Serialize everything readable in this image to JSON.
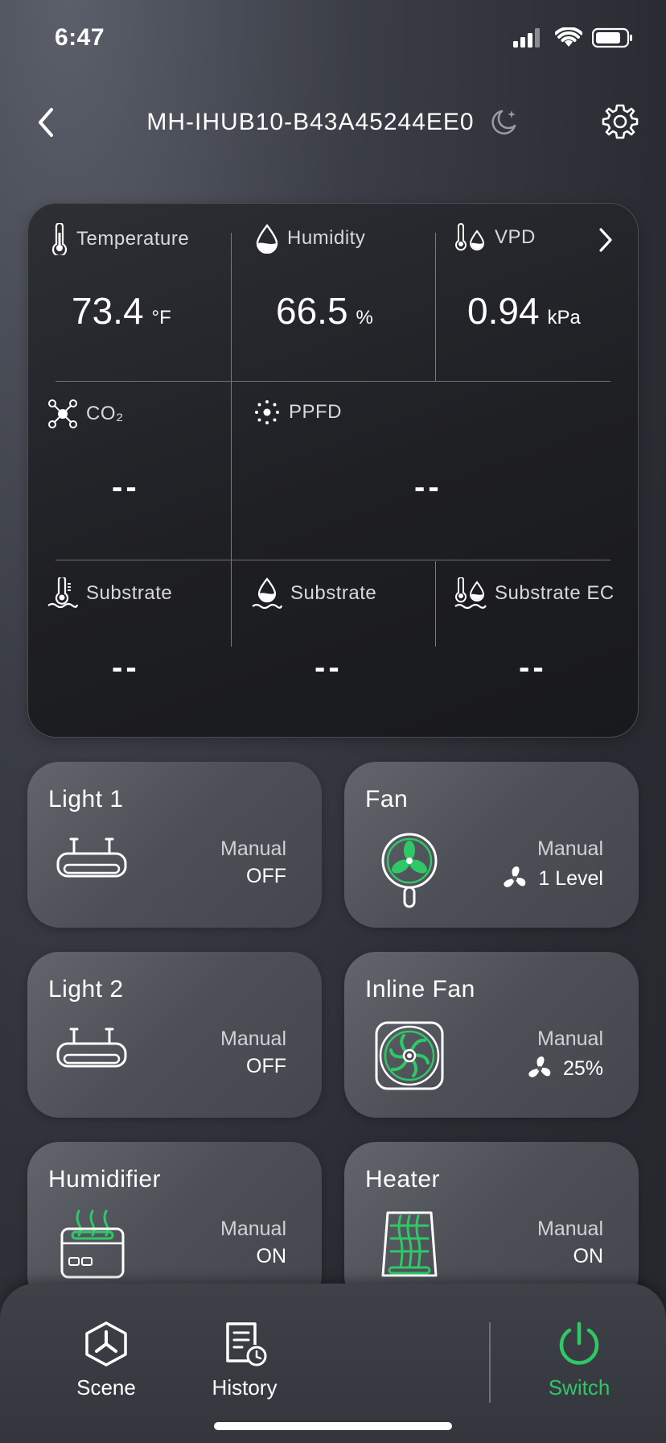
{
  "status_bar": {
    "time": "6:47",
    "icons": [
      "cellular-signal-icon",
      "wifi-icon",
      "battery-icon"
    ]
  },
  "header": {
    "title": "MH-IHUB10-B43A45244EE0",
    "icons": [
      "back-chevron-icon",
      "moon-icon",
      "gear-icon"
    ]
  },
  "sensors": {
    "temperature": {
      "label": "Temperature",
      "value": "73.4",
      "unit": "°F"
    },
    "humidity": {
      "label": "Humidity",
      "value": "66.5",
      "unit": "%"
    },
    "vpd": {
      "label": "VPD",
      "value": "0.94",
      "unit": "kPa"
    },
    "co2": {
      "label": "CO₂",
      "value": "--"
    },
    "ppfd": {
      "label": "PPFD",
      "value": "--"
    },
    "substrate_temp": {
      "label": "Substrate",
      "value": "--"
    },
    "substrate_humidity": {
      "label": "Substrate",
      "value": "--"
    },
    "substrate_ec": {
      "label": "Substrate EC",
      "value": "--"
    }
  },
  "devices": [
    {
      "name": "Light 1",
      "mode": "Manual",
      "state": "OFF",
      "icon": "grow-light-icon"
    },
    {
      "name": "Fan",
      "mode": "Manual",
      "state": "1 Level",
      "icon": "oscillating-fan-icon"
    },
    {
      "name": "Light 2",
      "mode": "Manual",
      "state": "OFF",
      "icon": "grow-light-icon"
    },
    {
      "name": "Inline Fan",
      "mode": "Manual",
      "state": "25%",
      "icon": "inline-fan-icon"
    },
    {
      "name": "Humidifier",
      "mode": "Manual",
      "state": "ON",
      "icon": "humidifier-icon"
    },
    {
      "name": "Heater",
      "mode": "Manual",
      "state": "ON",
      "icon": "heater-icon"
    }
  ],
  "bottom_nav": {
    "scene": "Scene",
    "history": "History",
    "switch": "Switch"
  },
  "colors": {
    "accent_green": "#2ec866",
    "card_dark": "#1e1f23",
    "device_card": "#55585f"
  }
}
